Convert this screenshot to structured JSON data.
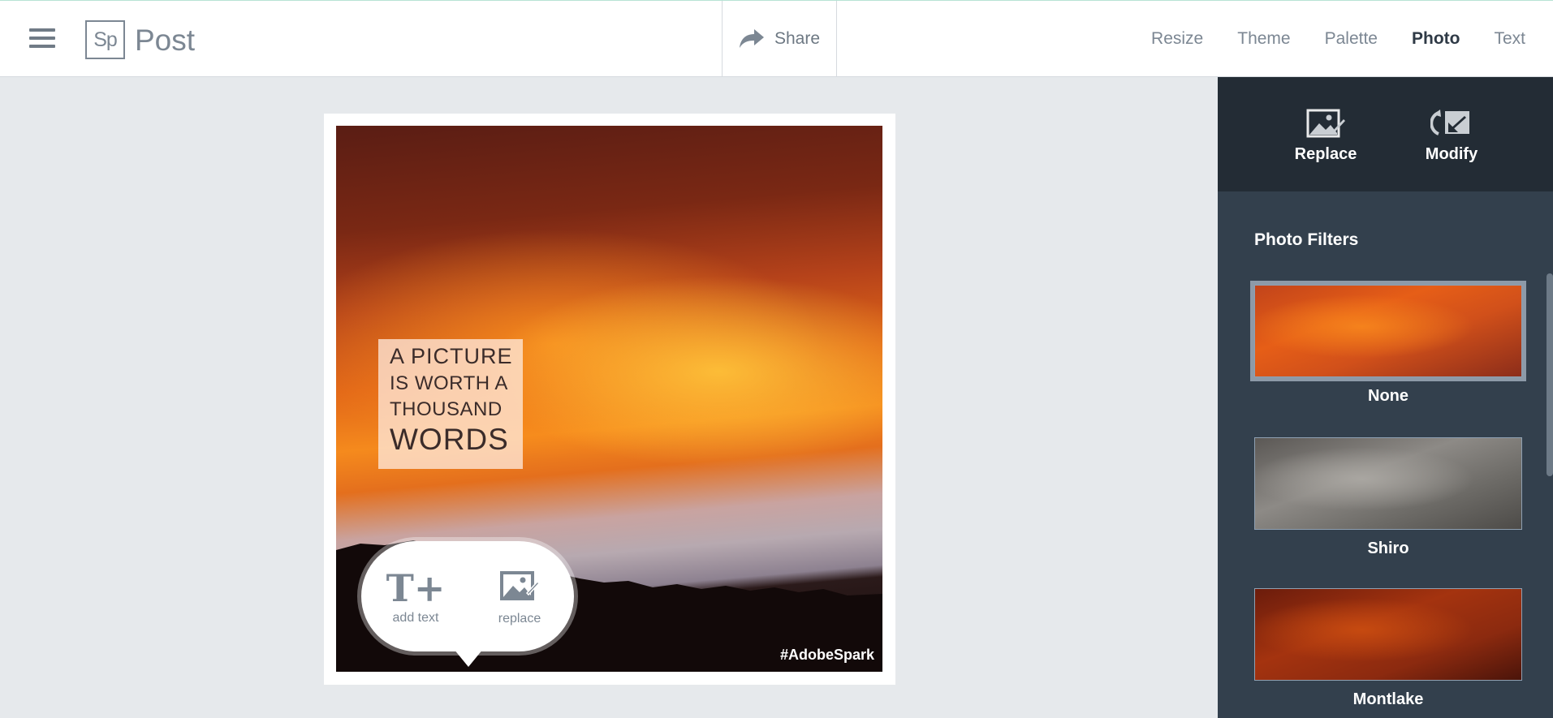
{
  "header": {
    "logo_text": "Sp",
    "app_title": "Post",
    "share_label": "Share",
    "tabs": [
      {
        "label": "Resize",
        "active": false
      },
      {
        "label": "Theme",
        "active": false
      },
      {
        "label": "Palette",
        "active": false
      },
      {
        "label": "Photo",
        "active": true
      },
      {
        "label": "Text",
        "active": false
      }
    ]
  },
  "canvas": {
    "quote_lines": [
      "A PICTURE",
      "IS WORTH A",
      "THOUSAND",
      "WORDS"
    ],
    "hashtag": "#AdobeSpark",
    "bubble": {
      "add_text_label": "add text",
      "replace_label": "replace"
    }
  },
  "panel": {
    "tools": {
      "replace_label": "Replace",
      "modify_label": "Modify"
    },
    "filters_title": "Photo Filters",
    "filters": [
      {
        "name": "None",
        "selected": true
      },
      {
        "name": "Shiro",
        "selected": false
      },
      {
        "name": "Montlake",
        "selected": false
      }
    ]
  },
  "colors": {
    "panel_bg": "#33404d",
    "panel_top_bg": "#232c35",
    "canvas_bg": "#e6e9ec",
    "muted_text": "#7c8793"
  }
}
